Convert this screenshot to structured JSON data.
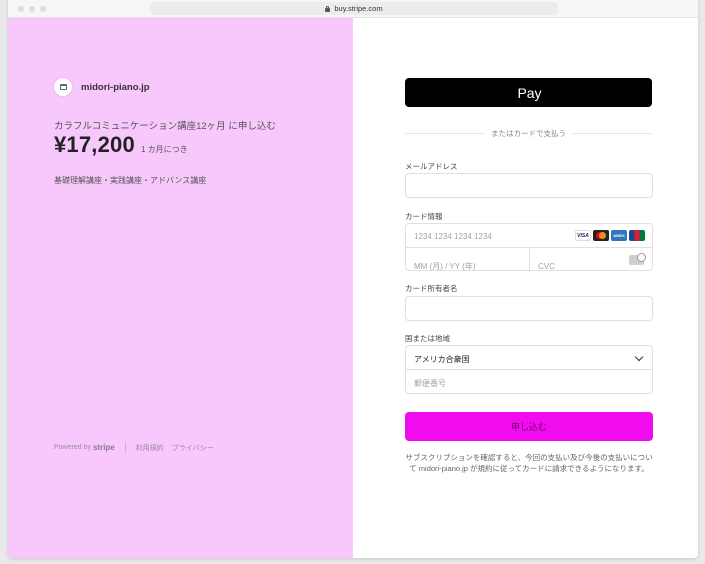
{
  "browser": {
    "url": "buy.stripe.com"
  },
  "summary": {
    "merchant": "midori-piano.jp",
    "product": "カラフルコミュニケーション講座12ヶ月 に申し込む",
    "price": "¥17,200",
    "period": "1 カ月につき",
    "description": "基礎理解講座・実践講座・アドバンス講座"
  },
  "footer": {
    "powered_by": "Powered by",
    "brand": "stripe",
    "terms": "利用規約",
    "privacy": "プライバシー"
  },
  "payment": {
    "apple_pay": "Pay",
    "divider": "またはカードで支払う",
    "email_label": "メールアドレス",
    "card_label": "カード情報",
    "card_number_placeholder": "1234 1234 1234 1234",
    "expiry_placeholder": "MM (月) / YY (年)",
    "cvc_placeholder": "CVC",
    "cardholder_label": "カード所有者名",
    "country_label": "国または地域",
    "country_value": "アメリカ合衆国",
    "postal_placeholder": "郵便番号",
    "submit": "申し込む",
    "terms": "サブスクリプションを確認すると、今回の支払い及び今後の支払いについて midori-piano.jp が規約に従ってカードに請求できるようになります。",
    "card_brands": [
      "VISA",
      "mastercard",
      "AMEX",
      "JCB"
    ]
  },
  "colors": {
    "left_bg": "#f8c7fb",
    "submit_bg": "#f00cee",
    "apple_pay_bg": "#000000"
  }
}
